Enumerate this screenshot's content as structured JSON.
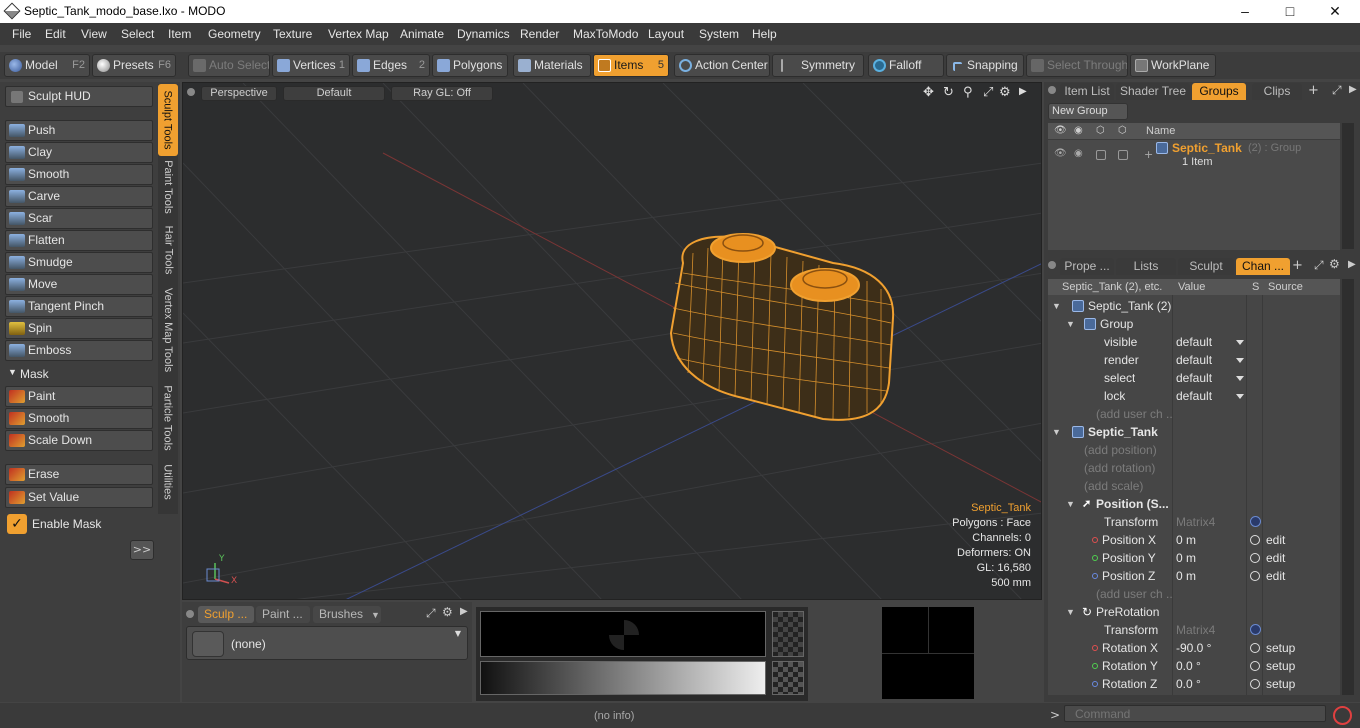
{
  "window": {
    "title": "Septic_Tank_modo_base.lxo - MODO"
  },
  "menu": [
    "File",
    "Edit",
    "View",
    "Select",
    "Item",
    "Geometry",
    "Texture",
    "Vertex Map",
    "Animate",
    "Dynamics",
    "Render",
    "MaxToModo",
    "Layout",
    "System",
    "Help"
  ],
  "toolbar": {
    "model": "Model",
    "model_key": "F2",
    "presets": "Presets",
    "presets_key": "F6",
    "auto_select": "Auto Select",
    "vertices": "Vertices",
    "vertices_key": "1",
    "edges": "Edges",
    "edges_key": "2",
    "polygons": "Polygons",
    "materials": "Materials",
    "items": "Items",
    "items_key": "5",
    "action_center": "Action Center",
    "symmetry": "Symmetry",
    "falloff": "Falloff",
    "snapping": "Snapping",
    "select_through": "Select Through",
    "workplane": "WorkPlane"
  },
  "left_panel": {
    "sculpt_hud": "Sculpt HUD",
    "tools": [
      "Push",
      "Clay",
      "Smooth",
      "Carve",
      "Scar",
      "Flatten",
      "Smudge",
      "Move",
      "Tangent Pinch",
      "Spin",
      "Emboss"
    ],
    "mask_header": "Mask",
    "mask_tools": [
      "Paint",
      "Smooth",
      "Scale Down"
    ],
    "erase": "Erase",
    "set_value": "Set Value",
    "enable_mask": "Enable Mask",
    "expand": ">>"
  },
  "vertical_tabs": [
    "Sculpt Tools",
    "Paint Tools",
    "Hair Tools",
    "Vertex Map Tools",
    "Particle Tools",
    "Utilities"
  ],
  "viewport": {
    "view": "Perspective",
    "style": "Default",
    "raygl": "Ray GL: Off",
    "info": {
      "name": "Septic_Tank",
      "polygons": "Polygons : Face",
      "channels": "Channels: 0",
      "deformers": "Deformers: ON",
      "gl": "GL: 16,580",
      "size": "500 mm"
    },
    "axis_y": "Y",
    "axis_x": "X"
  },
  "bottom_panel": {
    "tabs": [
      "Sculp ...",
      "Paint ...",
      "Brushes"
    ],
    "brush_value": "(none)"
  },
  "right_panel": {
    "top_tabs": [
      "Item List",
      "Shader Tree",
      "Groups",
      "Clips"
    ],
    "new_group": "New Group",
    "name_col": "Name",
    "group_name": "Septic_Tank",
    "group_suffix": "(2) : Group",
    "group_items": "1 Item",
    "mid_tabs": [
      "Prope ...",
      "Lists",
      "Sculpt",
      "Chan ..."
    ],
    "col_name": "Septic_Tank (2), etc.",
    "col_value": "Value",
    "col_s": "S",
    "col_source": "Source",
    "rows": [
      {
        "label": "Septic_Tank (2)"
      },
      {
        "label": "Group"
      },
      {
        "label": "visible",
        "value": "default"
      },
      {
        "label": "render",
        "value": "default"
      },
      {
        "label": "select",
        "value": "default"
      },
      {
        "label": "lock",
        "value": "default"
      },
      {
        "label": "(add user ch ..."
      },
      {
        "label": "Septic_Tank"
      },
      {
        "label": "(add position)"
      },
      {
        "label": "(add rotation)"
      },
      {
        "label": "(add scale)"
      },
      {
        "label": "Position (S..."
      },
      {
        "label": "Transform",
        "value": "Matrix4"
      },
      {
        "label": "Position X",
        "value": "0 m",
        "source": "edit"
      },
      {
        "label": "Position Y",
        "value": "0 m",
        "source": "edit"
      },
      {
        "label": "Position Z",
        "value": "0 m",
        "source": "edit"
      },
      {
        "label": "(add user ch ..."
      },
      {
        "label": "PreRotation"
      },
      {
        "label": "Transform",
        "value": "Matrix4"
      },
      {
        "label": "Rotation X",
        "value": "-90.0 °",
        "source": "setup"
      },
      {
        "label": "Rotation Y",
        "value": "0.0 °",
        "source": "setup"
      },
      {
        "label": "Rotation Z",
        "value": "0.0 °",
        "source": "setup"
      }
    ]
  },
  "status": {
    "info": "(no info)",
    "command_placeholder": "Command"
  },
  "colors": {
    "accent": "#f0a030",
    "viewport_bg": "#2c2d2e",
    "panel_bg": "#3e3e3e"
  }
}
